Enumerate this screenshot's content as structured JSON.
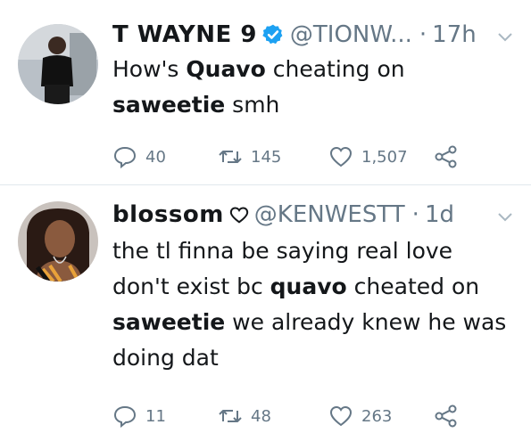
{
  "tweets": [
    {
      "display_name": "T WAYNE 9",
      "verified": true,
      "handle": "@TIONW...",
      "dot": "·",
      "time": "17h",
      "text_parts": [
        "How's ",
        "Quavo",
        " cheating on ",
        "saweetie",
        " smh"
      ],
      "replies": "40",
      "retweets": "145",
      "likes": "1,507"
    },
    {
      "display_name": "blossom",
      "handle": "@KENWESTT",
      "dot": "·",
      "time": "1d",
      "text_parts": [
        "the tl finna be saying real love don't exist bc ",
        "quavo",
        " cheated on ",
        "saweetie",
        " we already knew he was doing dat"
      ],
      "replies": "11",
      "retweets": "48",
      "likes": "263"
    }
  ],
  "colors": {
    "accent": "#1da1f2",
    "muted": "#657786",
    "text": "#14171a",
    "divider": "#e1e8ed"
  },
  "icons": [
    "verified-badge-icon",
    "heart-icon",
    "chevron-down-icon",
    "reply-icon",
    "retweet-icon",
    "like-icon",
    "share-icon"
  ]
}
